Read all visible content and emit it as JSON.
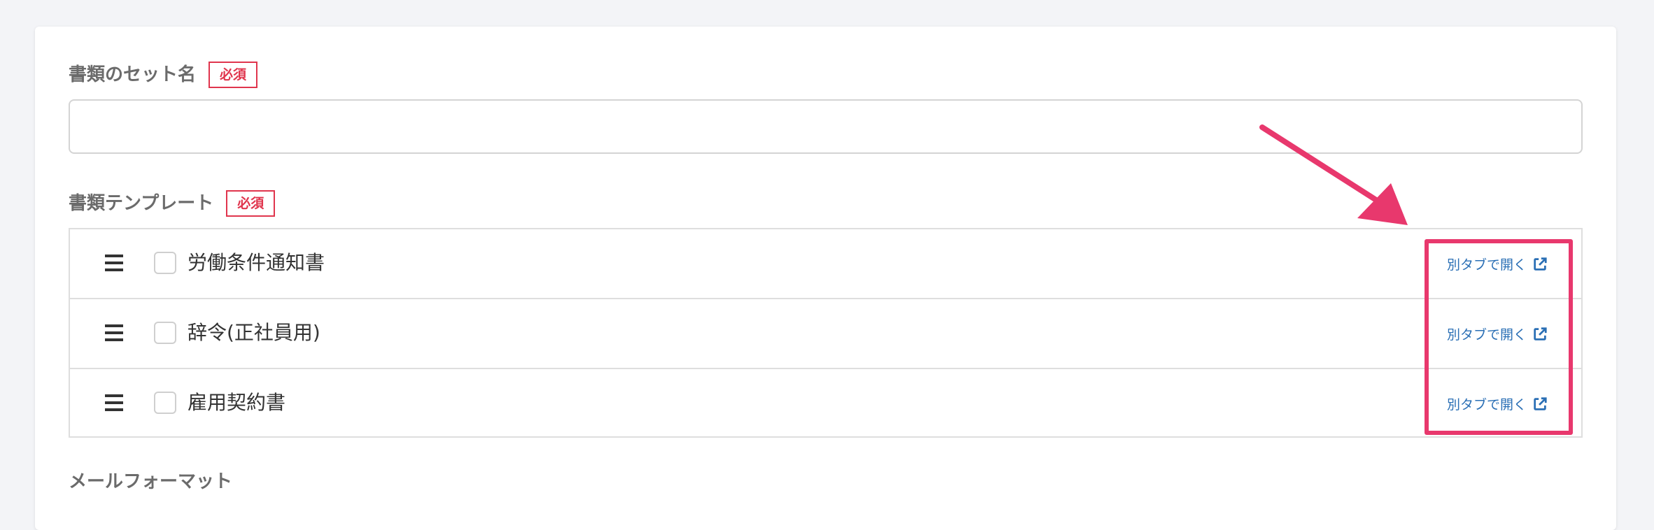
{
  "form": {
    "set_name": {
      "label": "書類のセット名",
      "required_badge": "必須",
      "value": "",
      "placeholder": ""
    },
    "templates": {
      "label": "書類テンプレート",
      "required_badge": "必須",
      "items": [
        {
          "name": "労働条件通知書",
          "checked": false,
          "link_label": "別タブで開く"
        },
        {
          "name": "辞令(正社員用)",
          "checked": false,
          "link_label": "別タブで開く"
        },
        {
          "name": "雇用契約書",
          "checked": false,
          "link_label": "別タブで開く"
        }
      ]
    },
    "mail_format": {
      "label": "メールフォーマット"
    }
  },
  "icons": {
    "drag_handle": "hamburger-icon",
    "open_link": "external-link-icon"
  },
  "colors": {
    "required": "#e0354d",
    "link": "#2a6fb5",
    "annotation": "#e8386d"
  }
}
